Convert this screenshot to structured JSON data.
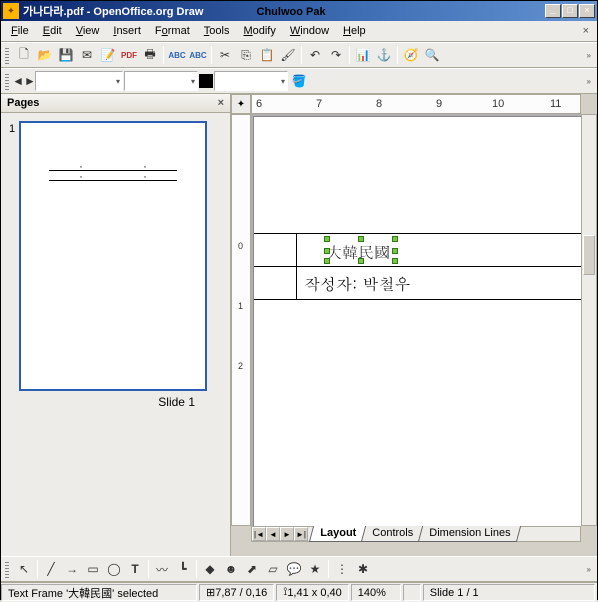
{
  "window": {
    "filename": "가나다라.pdf",
    "app": "OpenOffice.org Draw",
    "overlay": "Chulwoo Pak"
  },
  "menu": {
    "file": "File",
    "edit": "Edit",
    "view": "View",
    "insert": "Insert",
    "format": "Format",
    "tools": "Tools",
    "modify": "Modify",
    "window": "Window",
    "help": "Help"
  },
  "pages_panel": {
    "title": "Pages",
    "page_number": "1",
    "slide_label": "Slide 1"
  },
  "ruler": {
    "h": [
      "6",
      "7",
      "8",
      "9",
      "10",
      "11"
    ],
    "v": [
      "0",
      "1",
      "2"
    ]
  },
  "doc": {
    "row1_text": "大韓民國",
    "row2_text": "작성자: 박철우"
  },
  "tabs": {
    "layout": "Layout",
    "controls": "Controls",
    "dimlines": "Dimension Lines"
  },
  "status": {
    "selection": "Text Frame '大韓民國' selected",
    "pos": "7,87 / 0,16",
    "size": "1,41 x 0,40",
    "zoom": "140%",
    "slide": "Slide 1 / 1"
  }
}
